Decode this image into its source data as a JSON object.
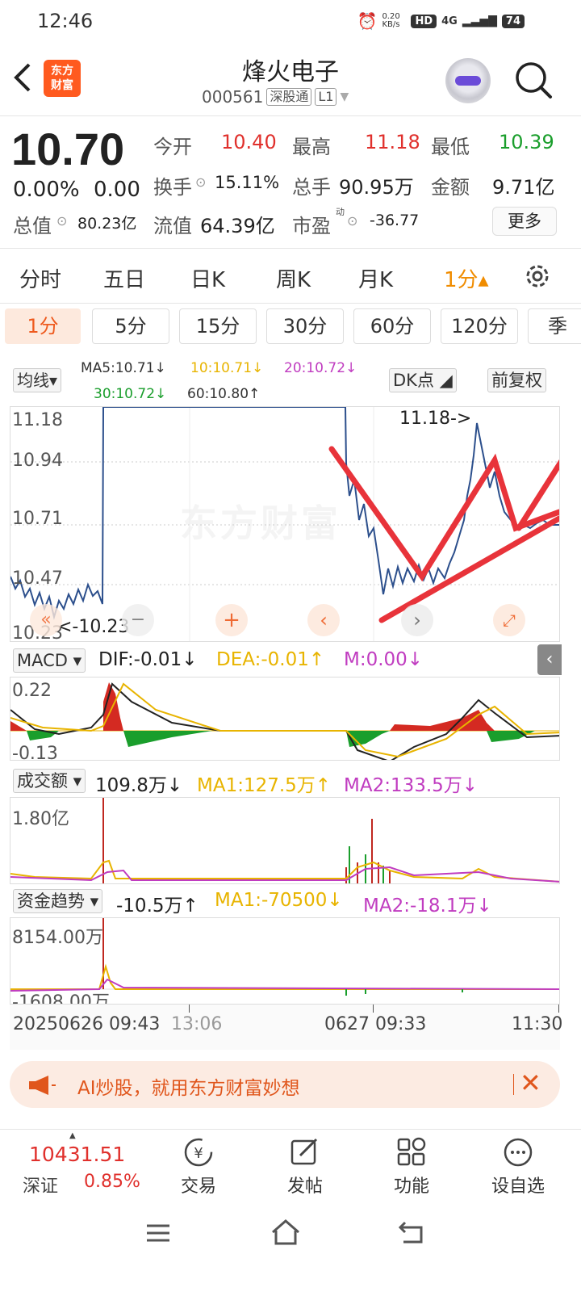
{
  "status_bar": {
    "time": "12:46",
    "net_speed": "0.20 KB/s",
    "hd": "HD",
    "signal": "4G",
    "battery": "74"
  },
  "header": {
    "logo_line1": "东方",
    "logo_line2": "财富",
    "stock_name": "烽火电子",
    "stock_code": "000561",
    "tag_connect": "深股通",
    "tag_level": "L1"
  },
  "quote": {
    "price": "10.70",
    "change_pct": "0.00%",
    "change_abs": "0.00",
    "open_label": "今开",
    "open": "10.40",
    "high_label": "最高",
    "high": "11.18",
    "low_label": "最低",
    "low": "10.39",
    "turnover_label": "换手",
    "turnover": "15.11%",
    "volume_label": "总手",
    "volume": "90.95万",
    "amount_label": "金额",
    "amount": "9.71亿",
    "mktcap_label": "总值",
    "mktcap": "80.23亿",
    "float_label": "流值",
    "float": "64.39亿",
    "pe_label": "市盈",
    "pe_sup": "动",
    "pe": "-36.77",
    "more": "更多"
  },
  "period_tabs": [
    "分时",
    "五日",
    "日K",
    "周K",
    "月K",
    "1分▴"
  ],
  "minute_tabs": [
    "1分",
    "5分",
    "15分",
    "30分",
    "60分",
    "120分",
    "季"
  ],
  "main_chart": {
    "indicator": "均线▾",
    "ma5": "MA5:10.71↓",
    "ma10": "10:10.71↓",
    "ma20": "20:10.72↓",
    "ma30": "30:10.72↓",
    "ma60": "60:10.80↑",
    "dk_label": "DK点",
    "adjust_label": "前复权",
    "y_labels": [
      "11.18",
      "10.94",
      "10.71",
      "10.47",
      "10.23"
    ],
    "high_annot": "11.18->",
    "low_annot": "<-10.23",
    "watermark": "东方财富"
  },
  "macd": {
    "selector": "MACD ▾",
    "dif": "DIF:-0.01↓",
    "dea": "DEA:-0.01↑",
    "m": "M:0.00↓",
    "y_top": "0.22",
    "y_bottom": "-0.13"
  },
  "volume_amt": {
    "selector": "成交额 ▾",
    "value": "109.8万↓",
    "ma1": "MA1:127.5万↑",
    "ma2": "MA2:133.5万↓",
    "y_top": "1.80亿"
  },
  "fund_flow": {
    "selector": "资金趋势 ▾",
    "value": "-10.5万↑",
    "ma1": "MA1:-70500↓",
    "ma2": "MA2:-18.1万↓",
    "y_top": "8154.00万",
    "y_bottom": "-1608.00万"
  },
  "x_axis": {
    "start": "20250626 09:43",
    "mid_ghost": "13:06",
    "mid": "0627 09:33",
    "end": "11:30"
  },
  "banner": {
    "text": "AI炒股，就用东方财富妙想"
  },
  "bottom_nav": {
    "index_value": "10431.51",
    "index_name": "深证",
    "index_change": "0.85%",
    "trade": "交易",
    "post": "发帖",
    "function": "功能",
    "watchlist": "设自选"
  },
  "colors": {
    "up": "#e0302c",
    "down": "#1a9e2c",
    "accent": "#f08c00",
    "price_line": "#2c4f8c"
  }
}
